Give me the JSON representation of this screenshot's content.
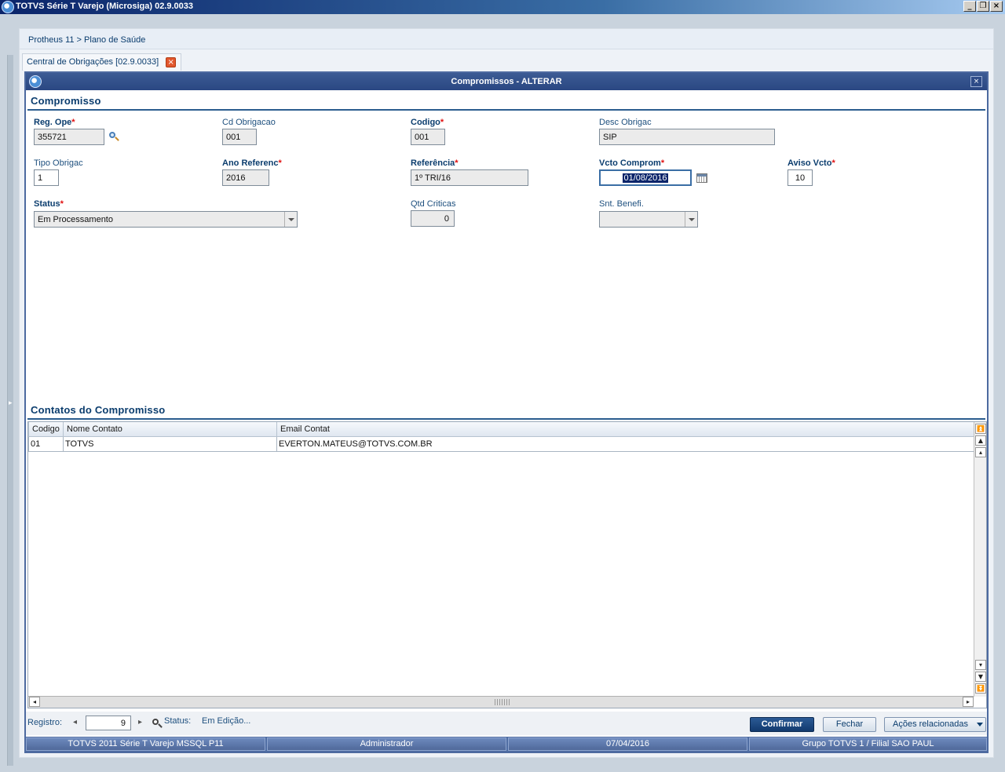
{
  "app": {
    "title": "TOTVS Série T Varejo (Microsiga) 02.9.0033"
  },
  "breadcrumb": "Protheus 11 > Plano de Saúde",
  "tab": {
    "label": "Central de Obrigações [02.9.0033]"
  },
  "dialog": {
    "title": "Compromissos - ALTERAR",
    "section_main": "Compromisso",
    "section_contacts": "Contatos do Compromisso"
  },
  "fields": {
    "reg_ope": {
      "label": "Reg. Ope",
      "value": "355721"
    },
    "cd_obrigacao": {
      "label": "Cd Obrigacao",
      "value": "001"
    },
    "codigo": {
      "label": "Codigo",
      "value": "001"
    },
    "desc_obrigac": {
      "label": "Desc Obrigac",
      "value": "SIP"
    },
    "tipo_obrigac": {
      "label": "Tipo Obrigac",
      "value": "1"
    },
    "ano_referenc": {
      "label": "Ano Referenc",
      "value": "2016"
    },
    "referencia": {
      "label": "Referência",
      "value": "1º TRI/16"
    },
    "vcto_comprom": {
      "label": "Vcto Comprom",
      "value": "01/08/2016"
    },
    "aviso_vcto": {
      "label": "Aviso Vcto",
      "value": "10"
    },
    "status": {
      "label": "Status",
      "value": "Em Processamento"
    },
    "qtd_criticas": {
      "label": "Qtd Criticas",
      "value": "0"
    },
    "snt_benefi": {
      "label": "Snt. Benefi.",
      "value": ""
    }
  },
  "required_marker": "*",
  "grid": {
    "columns": [
      "Codigo",
      "Nome Contato",
      "Email Contat"
    ],
    "rows": [
      [
        "01",
        "TOTVS",
        "EVERTON.MATEUS@TOTVS.COM.BR"
      ]
    ]
  },
  "footer": {
    "registro_label": "Registro:",
    "registro_value": "9",
    "status_label": "Status:",
    "status_value": "Em Edição...",
    "confirm_label": "Confirmar",
    "close_label": "Fechar",
    "actions_label": "Ações relacionadas"
  },
  "statusbar": {
    "product": "TOTVS 2011 Série T Varejo MSSQL P11",
    "user": "Administrador",
    "date": "07/04/2016",
    "branch": "Grupo TOTVS 1 / Filial SAO PAUL"
  },
  "colors": {
    "accent": "#0b3d6e",
    "dialog_title": "#2a4782",
    "required": "#e01010",
    "selection": "#0a246a"
  }
}
